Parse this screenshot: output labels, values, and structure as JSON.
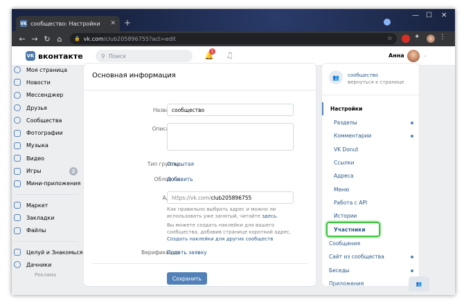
{
  "browser": {
    "tab_title": "сообщество: Настройки",
    "tab_favicon": "VK",
    "url_host": "vk.com",
    "url_path": "/club205896755?act=edit",
    "win_min": "—",
    "win_max": "☐",
    "win_close": "✕"
  },
  "header": {
    "logo_text": "вконтакте",
    "logo_mark": "VK",
    "search_placeholder": "Поиск",
    "notif_count": "1",
    "user_name": "Анна"
  },
  "left_menu": {
    "items": [
      {
        "label": "Моя страница"
      },
      {
        "label": "Новости"
      },
      {
        "label": "Мессенджер"
      },
      {
        "label": "Друзья"
      },
      {
        "label": "Сообщества"
      },
      {
        "label": "Фотографии"
      },
      {
        "label": "Музыка"
      },
      {
        "label": "Видео"
      },
      {
        "label": "Игры",
        "badge": "2"
      },
      {
        "label": "Мини-приложения"
      }
    ],
    "items2": [
      {
        "label": "Маркет"
      },
      {
        "label": "Закладки"
      },
      {
        "label": "Файлы"
      }
    ],
    "items3": [
      {
        "label": "Целуй и Знакомься"
      },
      {
        "label": "Дачники"
      }
    ],
    "ads_label": "Реклама"
  },
  "main": {
    "title": "Основная информация",
    "name_label": "Название:",
    "name_value": "сообщество",
    "desc_label": "Описание:",
    "type_label": "Тип группы:",
    "type_value": "Открытая",
    "cover_label": "Обложка:",
    "cover_value": "Добавить",
    "address_label": "Адрес:",
    "address_prefix": "https://vk.com/",
    "address_value": "club205896755",
    "address_note_1": "Как правильно выбрать адрес и можно ли использовать уже занятый, читайте",
    "address_note_link": "здесь",
    "address_note_2": "Вы можете создать наклейки для вашего сообщества, добавив странице короткий адрес.",
    "stickers_link": "Создать наклейки для других сообществ",
    "verify_label": "Верификация:",
    "verify_value": "Подать заявку",
    "save_label": "Сохранить"
  },
  "right_panel": {
    "group_name": "сообщество",
    "back_link": "вернуться к странице",
    "settings_label": "Настройки",
    "sub_items": [
      {
        "label": "Разделы",
        "dot": true
      },
      {
        "label": "Комментарии",
        "dot": true
      },
      {
        "label": "VK Donut",
        "dot": false
      },
      {
        "label": "Ссылки",
        "dot": false
      },
      {
        "label": "Адреса",
        "dot": false
      },
      {
        "label": "Меню",
        "dot": false
      },
      {
        "label": "Работа с API",
        "dot": false
      },
      {
        "label": "Истории",
        "dot": false
      },
      {
        "label": "Участники",
        "dot": false
      }
    ],
    "main_items": [
      {
        "label": "Сообщения",
        "dot": false
      },
      {
        "label": "Сайт из сообщества",
        "dot": true
      },
      {
        "label": "Беседы",
        "dot": true
      },
      {
        "label": "Приложения",
        "dot": false
      }
    ]
  },
  "colors": {
    "accent": "#5181b8",
    "link": "#2a5885",
    "highlight": "#3ac73a"
  }
}
